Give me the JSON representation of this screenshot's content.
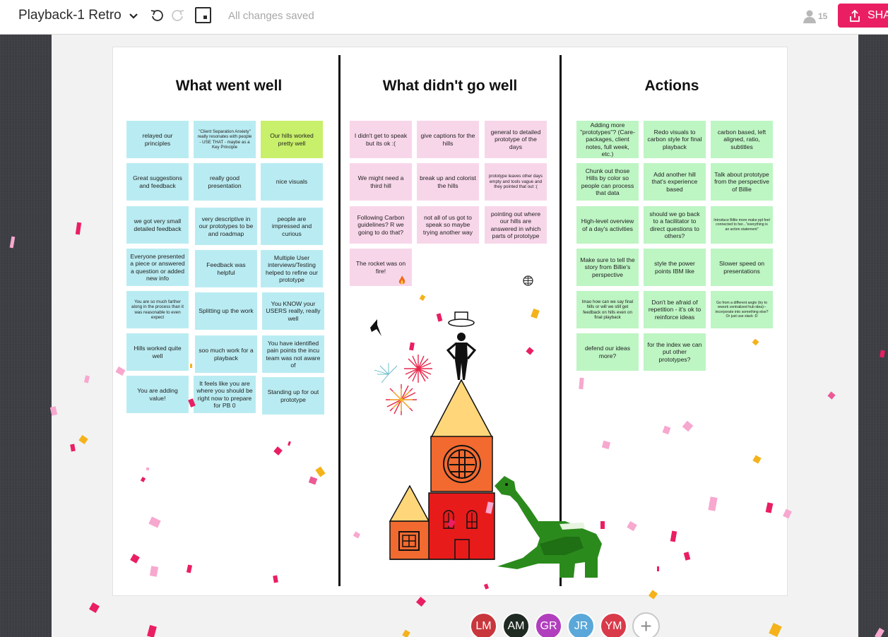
{
  "app": {
    "doc_title": "Playback-1 Retro",
    "save_status": "All changes saved",
    "viewer_count": "15",
    "share_label": "SHA",
    "accent": "#ea1e63"
  },
  "board": {
    "columns": [
      {
        "title": "What went well"
      },
      {
        "title": "What didn't go well"
      },
      {
        "title": "Actions"
      }
    ],
    "went_well": [
      "relayed our principles",
      "\"Client Separation Anxiety\" really resonates with people - USE THAT - maybe as a Key Principle",
      "Our hills worked pretty well",
      "Great suggestions and feedback",
      "really good presentation",
      "nice visuals",
      "we got very small detailed feedback",
      "very descriptive in our prototypes to be and roadmap",
      "people are impressed and curious",
      "Everyone presented a piece or answered a question or added new info",
      "Feedback was helpful",
      "Multiple User interviews/Testing helped to refine our prototype",
      "You are so much farther along in the process than it was reasonable to even expect",
      "Splitting up the work",
      "You KNOW your USERS really, really well",
      "Hills worked quite well",
      "soo much work for a playback",
      "You have identified pain points the incu team was not aware of",
      "You are adding value!",
      "It feels like you are where you should be right now to prepare for PB 0",
      "Standing up for out prototype"
    ],
    "didnt_go_well": [
      "I didn't get to speak but its ok :(",
      "give captions for the hills",
      "general to detailed prototype of the days",
      "We might need a third hill",
      "break up and colorist the hills",
      "prototype leaves other days empty and tools vague and they pointed that out :(",
      "Following Carbon guidelines? R we going to do that?",
      "not all of us got to speak so maybe trying another way",
      "pointing out where our hills are answered in which parts of prototype",
      "The rocket was on fire!"
    ],
    "actions": [
      "Adding more \"prototypes\"? (Care-packages, client notes, full week, etc.)",
      "Redo visuals to carbon style for final playback",
      "carbon based, left aligned, ratio, subtitles",
      "Chunk out those Hills by color so people can process that data",
      "Add another hill that's experience based",
      "Talk about prototype from the perspective of Billie",
      "High-level overview of a day's activities",
      "should we go back to a facilitator to direct questions to others?",
      "Introduce Billie more make ppl feel connected to her...\"everything is an action statement\"",
      "Make sure to tell the story from Billie's perspective",
      "style the power points IBM like",
      "Slower speed on presentations",
      "lmao how can we say final hills or will we still get feedback on hills even on final playback",
      "Don't be afraid of repetition - it's ok to reinforce ideas",
      "Go from a different angle (try to rework centralized hub idea)--incorporate into something else? Or just use slack :D",
      "defend our ideas more?",
      "for the index we can put other prototypes?"
    ]
  },
  "collaborators": [
    {
      "initials": "LM",
      "color": "#c8373c"
    },
    {
      "initials": "AM",
      "color": "#1f2a22"
    },
    {
      "initials": "GR",
      "color": "#b13fbd"
    },
    {
      "initials": "JR",
      "color": "#5aa8d9"
    },
    {
      "initials": "YM",
      "color": "#d93a4a"
    }
  ],
  "icons": {
    "chevron": "chevron-down-icon",
    "undo": "undo-icon",
    "redo": "redo-icon",
    "present": "present-icon",
    "viewers": "person-icon",
    "share": "share-icon",
    "add": "plus-icon"
  }
}
